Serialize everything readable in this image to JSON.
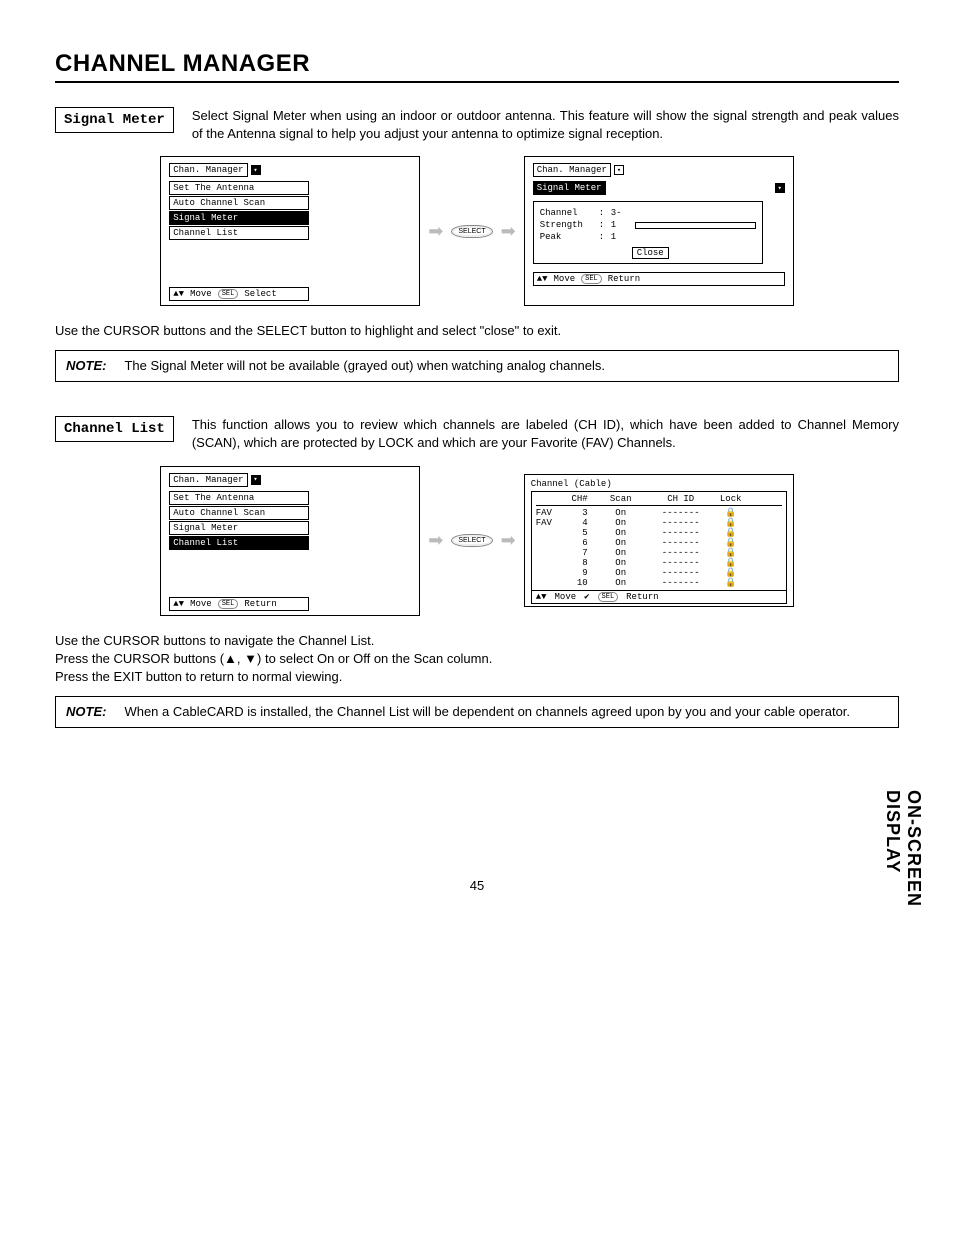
{
  "page": {
    "title": "CHANNEL MANAGER",
    "number": "45",
    "side_tab": "ON-SCREEN DISPLAY"
  },
  "signal_meter": {
    "label": "Signal Meter",
    "desc": "Select Signal Meter when using an indoor or outdoor antenna.  This feature will show the signal strength and peak values of the Antenna signal to help  you adjust your antenna to optimize signal reception.",
    "menu": {
      "title": "Chan. Manager",
      "items": [
        "Set The Antenna",
        "Auto Channel Scan",
        "Signal Meter",
        "Channel List"
      ],
      "highlight_index": 2,
      "footer_move": "Move",
      "footer_action": "Select",
      "sel_label": "SEL"
    },
    "select_button": "SELECT",
    "detail": {
      "title": "Chan. Manager",
      "sub": "Signal Meter",
      "rows": [
        {
          "label": "Channel",
          "value": "3-"
        },
        {
          "label": "Strength",
          "value": "1",
          "bar": true
        },
        {
          "label": "Peak",
          "value": "1"
        }
      ],
      "close": "Close",
      "footer_move": "Move",
      "footer_action": "Return",
      "sel_label": "SEL"
    },
    "instr": "Use the CURSOR buttons and the SELECT button to highlight and select \"close\" to exit.",
    "note_label": "NOTE:",
    "note_text": "The Signal Meter will not be available (grayed out) when watching analog channels."
  },
  "channel_list": {
    "label": "Channel List",
    "desc": "This function allows you to review which channels are labeled (CH ID), which have been added to Channel Memory (SCAN), which are protected by LOCK and which are your Favorite (FAV) Channels.",
    "menu": {
      "title": "Chan. Manager",
      "items": [
        "Set The Antenna",
        "Auto Channel Scan",
        "Signal Meter",
        "Channel List"
      ],
      "highlight_index": 3,
      "footer_move": "Move",
      "footer_action": "Return",
      "sel_label": "SEL"
    },
    "select_button": "SELECT",
    "table": {
      "title": "Channel (Cable)",
      "headers": {
        "ch": "CH#",
        "scan": "Scan",
        "id": "CH ID",
        "lock": "Lock"
      },
      "rows": [
        {
          "fav": "FAV",
          "ch": "3",
          "scan": "On",
          "id": "-------",
          "lock": "🔒"
        },
        {
          "fav": "FAV",
          "ch": "4",
          "scan": "On",
          "id": "-------",
          "lock": "🔒"
        },
        {
          "fav": "",
          "ch": "5",
          "scan": "On",
          "id": "-------",
          "lock": "🔒"
        },
        {
          "fav": "",
          "ch": "6",
          "scan": "On",
          "id": "-------",
          "lock": "🔒"
        },
        {
          "fav": "",
          "ch": "7",
          "scan": "On",
          "id": "-------",
          "lock": "🔒"
        },
        {
          "fav": "",
          "ch": "8",
          "scan": "On",
          "id": "-------",
          "lock": "🔒"
        },
        {
          "fav": "",
          "ch": "9",
          "scan": "On",
          "id": "-------",
          "lock": "🔒"
        },
        {
          "fav": "",
          "ch": "10",
          "scan": "On",
          "id": "-------",
          "lock": "🔒"
        }
      ],
      "footer_move": "Move",
      "footer_action": "Return",
      "sel_label": "SEL"
    },
    "instr1": "Use the CURSOR buttons to navigate the Channel List.",
    "instr2": "Press the CURSOR buttons (▲, ▼) to select On or Off on the Scan column.",
    "instr3": "Press the EXIT button to return to normal viewing.",
    "note_label": "NOTE:",
    "note_text": "When a CableCARD is installed, the Channel List will be dependent on channels agreed upon by you and your cable operator."
  }
}
